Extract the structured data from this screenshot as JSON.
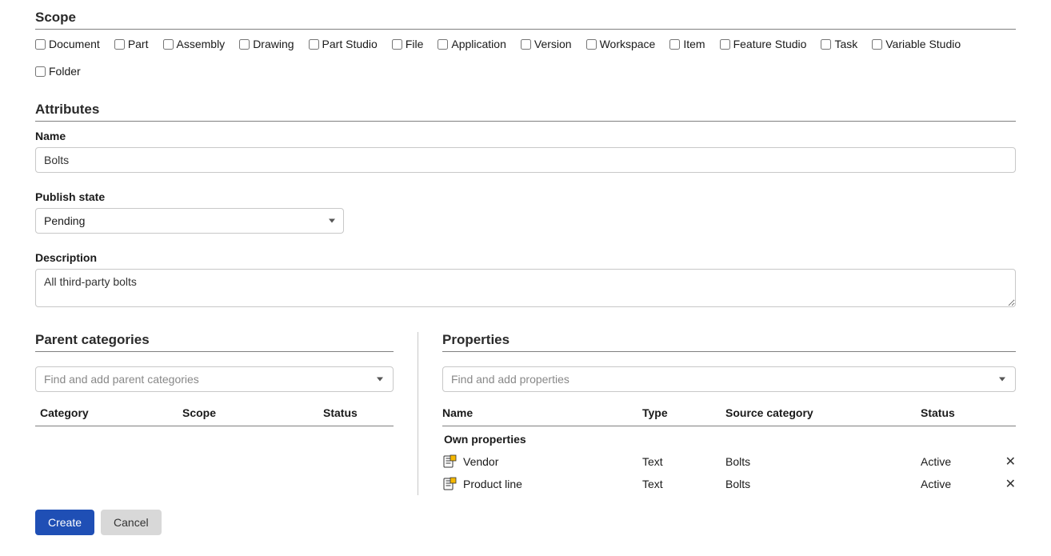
{
  "scope": {
    "title": "Scope",
    "items": [
      {
        "label": "Document",
        "checked": false
      },
      {
        "label": "Part",
        "checked": false
      },
      {
        "label": "Assembly",
        "checked": false
      },
      {
        "label": "Drawing",
        "checked": false
      },
      {
        "label": "Part Studio",
        "checked": false
      },
      {
        "label": "File",
        "checked": false
      },
      {
        "label": "Application",
        "checked": false
      },
      {
        "label": "Version",
        "checked": false
      },
      {
        "label": "Workspace",
        "checked": false
      },
      {
        "label": "Item",
        "checked": false
      },
      {
        "label": "Feature Studio",
        "checked": false
      },
      {
        "label": "Task",
        "checked": false
      },
      {
        "label": "Variable Studio",
        "checked": false
      },
      {
        "label": "Folder",
        "checked": false
      }
    ]
  },
  "attributes": {
    "title": "Attributes",
    "name_label": "Name",
    "name_value": "Bolts",
    "publish_state_label": "Publish state",
    "publish_state_value": "Pending",
    "description_label": "Description",
    "description_value": "All third-party bolts"
  },
  "parent_categories": {
    "title": "Parent categories",
    "search_placeholder": "Find and add parent categories",
    "columns": {
      "category": "Category",
      "scope": "Scope",
      "status": "Status"
    }
  },
  "properties": {
    "title": "Properties",
    "search_placeholder": "Find and add properties",
    "columns": {
      "name": "Name",
      "type": "Type",
      "source_category": "Source category",
      "status": "Status"
    },
    "group_label": "Own properties",
    "rows": [
      {
        "name": "Vendor",
        "type": "Text",
        "source_category": "Bolts",
        "status": "Active"
      },
      {
        "name": "Product line",
        "type": "Text",
        "source_category": "Bolts",
        "status": "Active"
      }
    ]
  },
  "footer": {
    "create": "Create",
    "cancel": "Cancel"
  }
}
